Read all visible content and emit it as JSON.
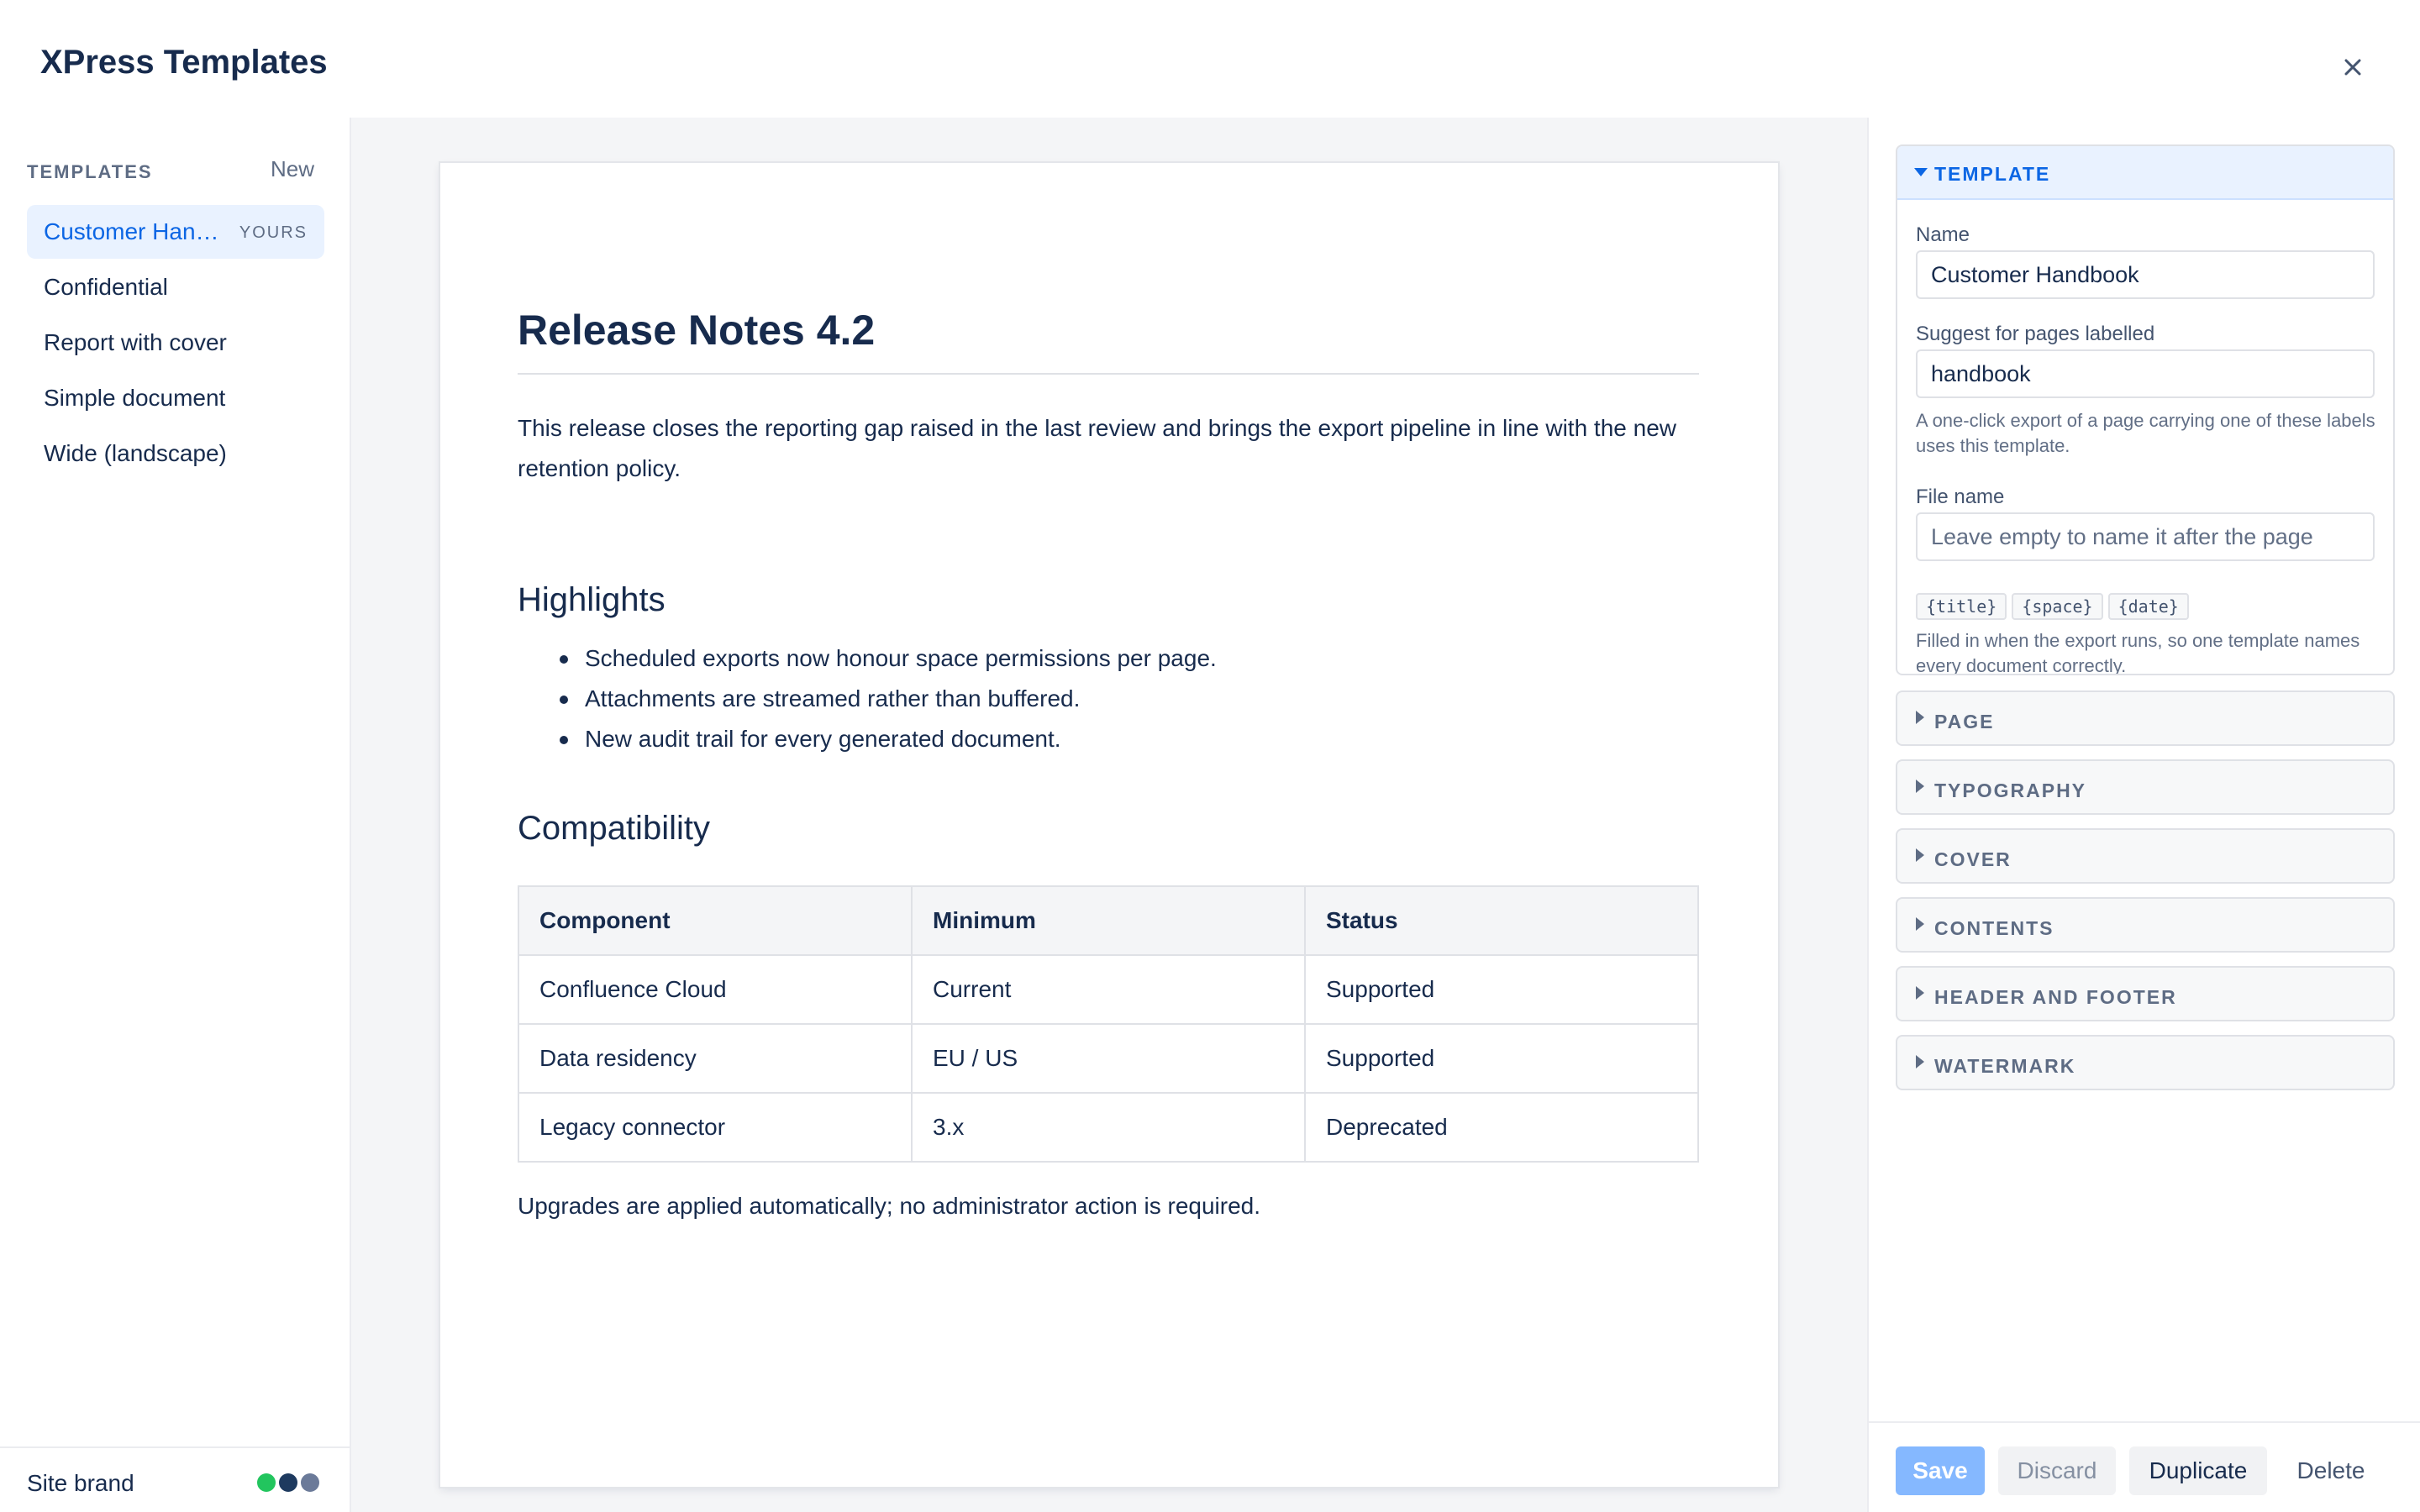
{
  "modal": {
    "title": "XPress Templates"
  },
  "sidebar": {
    "heading": "TEMPLATES",
    "new_label": "New",
    "items": [
      {
        "label": "Customer Handbook",
        "badge": "YOURS",
        "selected": true
      },
      {
        "label": "Confidential"
      },
      {
        "label": "Report with cover"
      },
      {
        "label": "Simple document"
      },
      {
        "label": "Wide (landscape)"
      }
    ],
    "brand_label": "Site brand",
    "brand_colors": [
      "#22c55e",
      "#1e3a5f",
      "#6b7a99"
    ]
  },
  "preview": {
    "title": "Release Notes 4.2",
    "intro": "This release closes the reporting gap raised in the last review and brings the export pipeline in line with the new retention policy.",
    "highlights_heading": "Highlights",
    "highlights": [
      "Scheduled exports now honour space permissions per page.",
      "Attachments are streamed rather than buffered.",
      "New audit trail for every generated document."
    ],
    "compat_heading": "Compatibility",
    "table": {
      "headers": [
        "Component",
        "Minimum",
        "Status"
      ],
      "rows": [
        [
          "Confluence Cloud",
          "Current",
          "Supported"
        ],
        [
          "Data residency",
          "EU / US",
          "Supported"
        ],
        [
          "Legacy connector",
          "3.x",
          "Deprecated"
        ]
      ]
    },
    "footer_note": "Upgrades are applied automatically; no administrator action is required."
  },
  "settings": {
    "template_section": {
      "label": "TEMPLATE",
      "name_label": "Name",
      "name_value": "Customer Handbook",
      "labels_label": "Suggest for pages labelled",
      "labels_value": "handbook",
      "labels_help": "A one-click export of a page carrying one of these labels uses this template.",
      "filename_label": "File name",
      "filename_placeholder": "Leave empty to name it after the page",
      "tokens": [
        "{title}",
        "{space}",
        "{date}"
      ],
      "filename_help": "Filled in when the export runs, so one template names every document correctly."
    },
    "sections": [
      "PAGE",
      "TYPOGRAPHY",
      "COVER",
      "CONTENTS",
      "HEADER AND FOOTER",
      "WATERMARK"
    ]
  },
  "actions": {
    "save": "Save",
    "discard": "Discard",
    "duplicate": "Duplicate",
    "delete": "Delete"
  },
  "colors": {
    "accent": "#0c66e4",
    "selected_bg": "#e9f2ff",
    "text": "#172b4d",
    "save_disabled": "#85b8ff"
  }
}
